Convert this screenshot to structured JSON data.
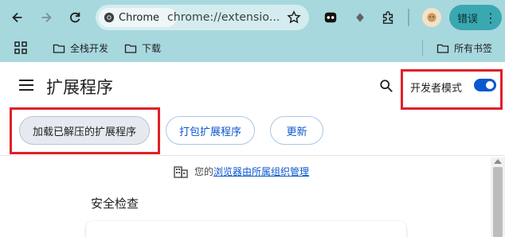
{
  "toolbar": {
    "site_chip_label": "Chrome",
    "url": "chrome://extensio...",
    "error_chip_label": "错误",
    "error_chip_menu": "⋮"
  },
  "bookmarks": {
    "items": [
      {
        "label": "全栈开发"
      },
      {
        "label": "下载"
      }
    ],
    "all_bookmarks_label": "所有书签"
  },
  "page": {
    "title": "扩展程序",
    "dev_mode_label": "开发者模式",
    "dev_mode_enabled": true,
    "buttons": {
      "load_unpacked": "加载已解压的扩展程序",
      "pack": "打包扩展程序",
      "update": "更新"
    },
    "managed_prefix": "您的",
    "managed_link": "浏览器由所属组织管理",
    "safety_check_title": "安全检查"
  },
  "colors": {
    "toolbar_bg": "#a7d8de",
    "accent": "#0b57d0",
    "highlight_box": "#e0202a"
  }
}
